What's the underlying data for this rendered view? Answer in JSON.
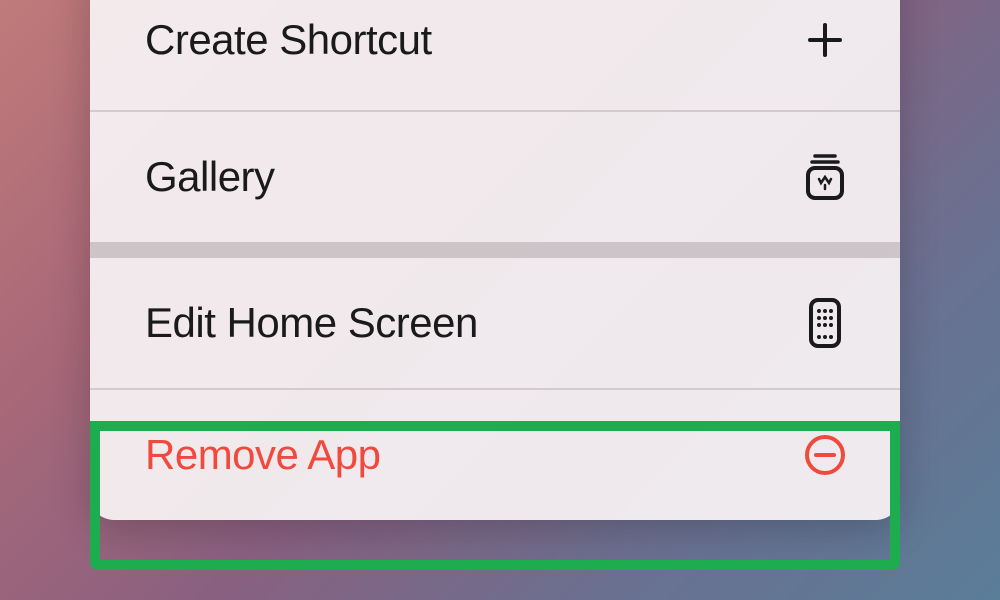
{
  "menu": {
    "items": [
      {
        "label": "Create Shortcut",
        "icon": "plus-icon",
        "destructive": false
      },
      {
        "label": "Gallery",
        "icon": "gallery-icon",
        "destructive": false
      },
      {
        "label": "Edit Home Screen",
        "icon": "homescreen-icon",
        "destructive": false
      },
      {
        "label": "Remove App",
        "icon": "remove-icon",
        "destructive": true
      }
    ]
  },
  "highlighted_item_index": 3
}
